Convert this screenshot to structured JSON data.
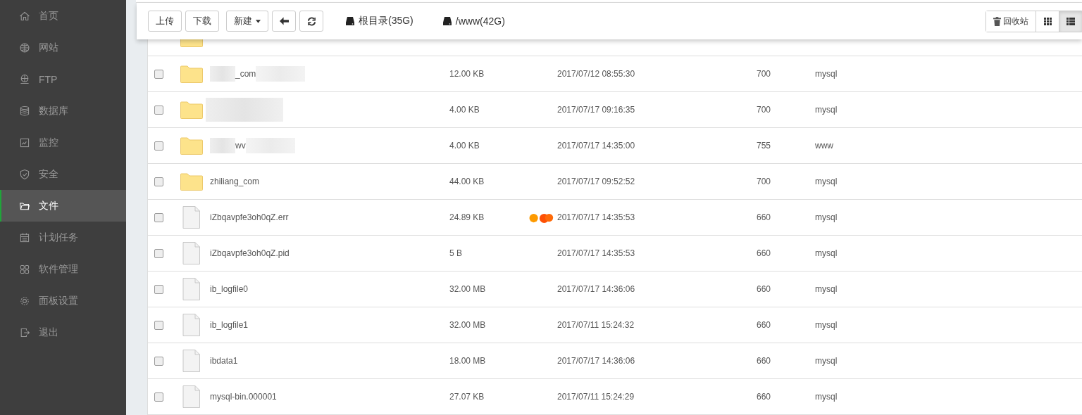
{
  "sidebar": {
    "items": [
      {
        "label": "首页",
        "selected": false
      },
      {
        "label": "网站",
        "selected": false
      },
      {
        "label": "FTP",
        "selected": false
      },
      {
        "label": "数据库",
        "selected": false
      },
      {
        "label": "监控",
        "selected": false
      },
      {
        "label": "安全",
        "selected": false
      },
      {
        "label": "文件",
        "selected": true
      },
      {
        "label": "计划任务",
        "selected": false
      },
      {
        "label": "软件管理",
        "selected": false
      },
      {
        "label": "面板设置",
        "selected": false
      },
      {
        "label": "退出",
        "selected": false
      }
    ]
  },
  "toolbar": {
    "buttons": [
      {
        "label": "上传",
        "kind": "text"
      },
      {
        "label": "下载",
        "kind": "text"
      },
      {
        "label": "新建",
        "kind": "dropdown"
      },
      {
        "kind": "back"
      },
      {
        "kind": "refresh"
      }
    ],
    "disks": [
      {
        "label": "根目录(35G)"
      },
      {
        "label": "/www(42G)"
      }
    ],
    "recycle": "回收站",
    "views": [
      {
        "kind": "grid",
        "selected": false
      },
      {
        "kind": "list",
        "selected": true
      }
    ]
  },
  "files": [
    {
      "kind": "folder"
    },
    {
      "kind": "folder",
      "name": "_com",
      "blurred": true,
      "size": "12.00 KB",
      "modified": "2017/07/12 08:55:30",
      "permission": "700",
      "owner": "mysql",
      "checked": false
    },
    {
      "kind": "folder",
      "blurred": true,
      "size": "4.00 KB",
      "modified": "2017/07/17 09:16:35",
      "permission": "700",
      "owner": "mysql",
      "checked": false
    },
    {
      "kind": "folder",
      "name": "wv",
      "blurred": true,
      "size": "4.00 KB",
      "modified": "2017/07/17 14:35:00",
      "permission": "755",
      "owner": "www",
      "checked": false
    },
    {
      "kind": "folder",
      "name": "zhiliang_com",
      "size": "44.00 KB",
      "modified": "2017/07/17 09:52:52",
      "permission": "700",
      "owner": "mysql",
      "checked": false
    },
    {
      "kind": "file",
      "name": "iZbqavpfe3oh0qZ.err",
      "size": "24.89 KB",
      "modified": "2017/07/17 14:35:53",
      "permission": "660",
      "owner": "mysql",
      "checked": false,
      "loading": true
    },
    {
      "kind": "file",
      "name": "iZbqavpfe3oh0qZ.pid",
      "size": "5 B",
      "modified": "2017/07/17 14:35:53",
      "permission": "660",
      "owner": "mysql",
      "checked": false
    },
    {
      "kind": "file",
      "name": "ib_logfile0",
      "size": "32.00 MB",
      "modified": "2017/07/17 14:36:06",
      "permission": "660",
      "owner": "mysql",
      "checked": false
    },
    {
      "kind": "file",
      "name": "ib_logfile1",
      "size": "32.00 MB",
      "modified": "2017/07/11 15:24:32",
      "permission": "660",
      "owner": "mysql",
      "checked": false
    },
    {
      "kind": "file",
      "name": "ibdata1",
      "size": "18.00 MB",
      "modified": "2017/07/17 14:36:06",
      "permission": "660",
      "owner": "mysql",
      "checked": false
    },
    {
      "kind": "file",
      "name": "mysql-bin.000001",
      "size": "27.07 KB",
      "modified": "2017/07/11 15:24:29",
      "permission": "660",
      "owner": "mysql",
      "checked": false
    }
  ]
}
